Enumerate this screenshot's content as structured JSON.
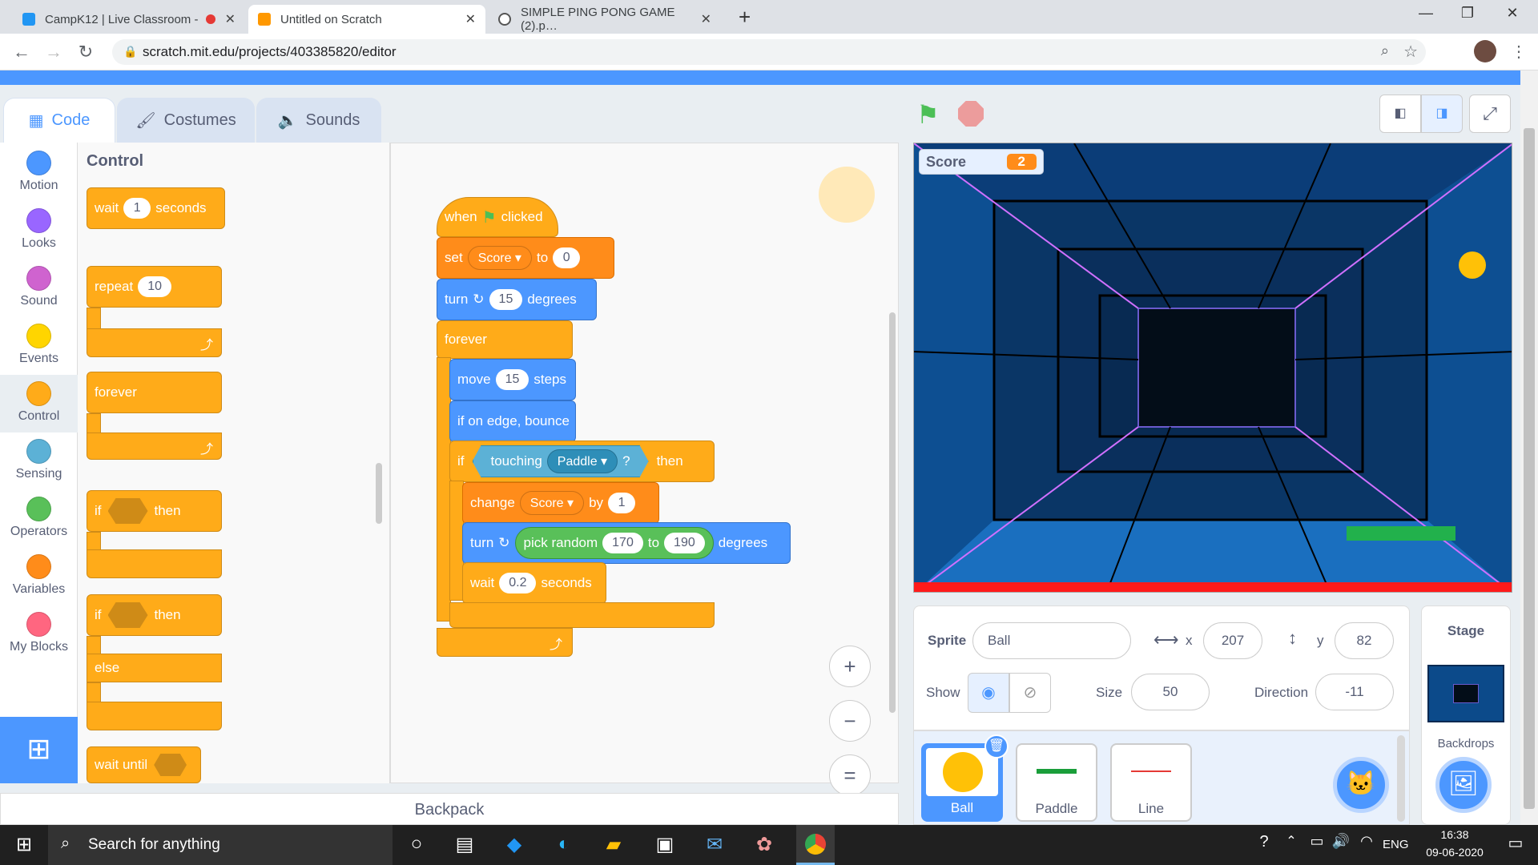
{
  "browser": {
    "tabs": [
      {
        "title": "CampK12 | Live Classroom -",
        "favicon_color": "#2196f3",
        "active": false
      },
      {
        "title": "Untitled on Scratch",
        "favicon_color": "#ff9800",
        "active": true
      },
      {
        "title": "SIMPLE PING PONG GAME (2).p…",
        "favicon_color": "#555555",
        "active": false
      }
    ],
    "new_tab": "+",
    "url": "scratch.mit.edu/projects/403385820/editor",
    "window": {
      "minimize": "—",
      "maximize": "❐",
      "close": "✕"
    }
  },
  "editor": {
    "tabs": {
      "code": "Code",
      "costumes": "Costumes",
      "sounds": "Sounds"
    },
    "categories": [
      {
        "label": "Motion",
        "color": "#4c97ff"
      },
      {
        "label": "Looks",
        "color": "#9966ff"
      },
      {
        "label": "Sound",
        "color": "#cf63cf"
      },
      {
        "label": "Events",
        "color": "#ffd500"
      },
      {
        "label": "Control",
        "color": "#ffab19"
      },
      {
        "label": "Sensing",
        "color": "#5cb1d6"
      },
      {
        "label": "Operators",
        "color": "#59c059"
      },
      {
        "label": "Variables",
        "color": "#ff8c1a"
      },
      {
        "label": "My Blocks",
        "color": "#ff6680"
      }
    ],
    "palette": {
      "heading": "Control",
      "wait": {
        "label": "wait",
        "value": "1",
        "unit": "seconds"
      },
      "repeat": {
        "label": "repeat",
        "value": "10"
      },
      "forever": "forever",
      "if_then": {
        "if": "if",
        "then": "then"
      },
      "if_else": {
        "if": "if",
        "then": "then",
        "else": "else"
      },
      "wait_until": "wait until"
    },
    "script": {
      "hat": {
        "when": "when",
        "clicked": "clicked"
      },
      "set": {
        "label": "set",
        "var": "Score",
        "to": "to",
        "value": "0"
      },
      "turn1": {
        "label": "turn",
        "value": "15",
        "unit": "degrees"
      },
      "forever": "forever",
      "move": {
        "label": "move",
        "value": "15",
        "unit": "steps"
      },
      "bounce": "if on edge, bounce",
      "if": {
        "if": "if",
        "touching": "touching",
        "target": "Paddle",
        "q": "?",
        "then": "then"
      },
      "change": {
        "label": "change",
        "var": "Score",
        "by": "by",
        "value": "1"
      },
      "turn2": {
        "label": "turn",
        "random": "pick random",
        "from": "170",
        "to": "to",
        "max": "190",
        "unit": "degrees"
      },
      "wait": {
        "label": "wait",
        "value": "0.2",
        "unit": "seconds"
      }
    },
    "zoom": {
      "in": "+",
      "out": "−",
      "reset": "="
    },
    "backpack": "Backpack"
  },
  "stage": {
    "monitor": {
      "label": "Score",
      "value": "2"
    }
  },
  "sprite_info": {
    "sprite_label": "Sprite",
    "sprite_name": "Ball",
    "x_label": "x",
    "x": "207",
    "y_label": "y",
    "y": "82",
    "show_label": "Show",
    "size_label": "Size",
    "size": "50",
    "direction_label": "Direction",
    "direction": "-11"
  },
  "sprites": [
    {
      "name": "Ball",
      "selected": true
    },
    {
      "name": "Paddle",
      "selected": false
    },
    {
      "name": "Line",
      "selected": false
    }
  ],
  "stage_panel": {
    "title": "Stage",
    "backdrops": "Backdrops"
  },
  "taskbar": {
    "search": "Search for anything",
    "lang": "ENG",
    "time": "16:38",
    "date": "09-06-2020"
  }
}
